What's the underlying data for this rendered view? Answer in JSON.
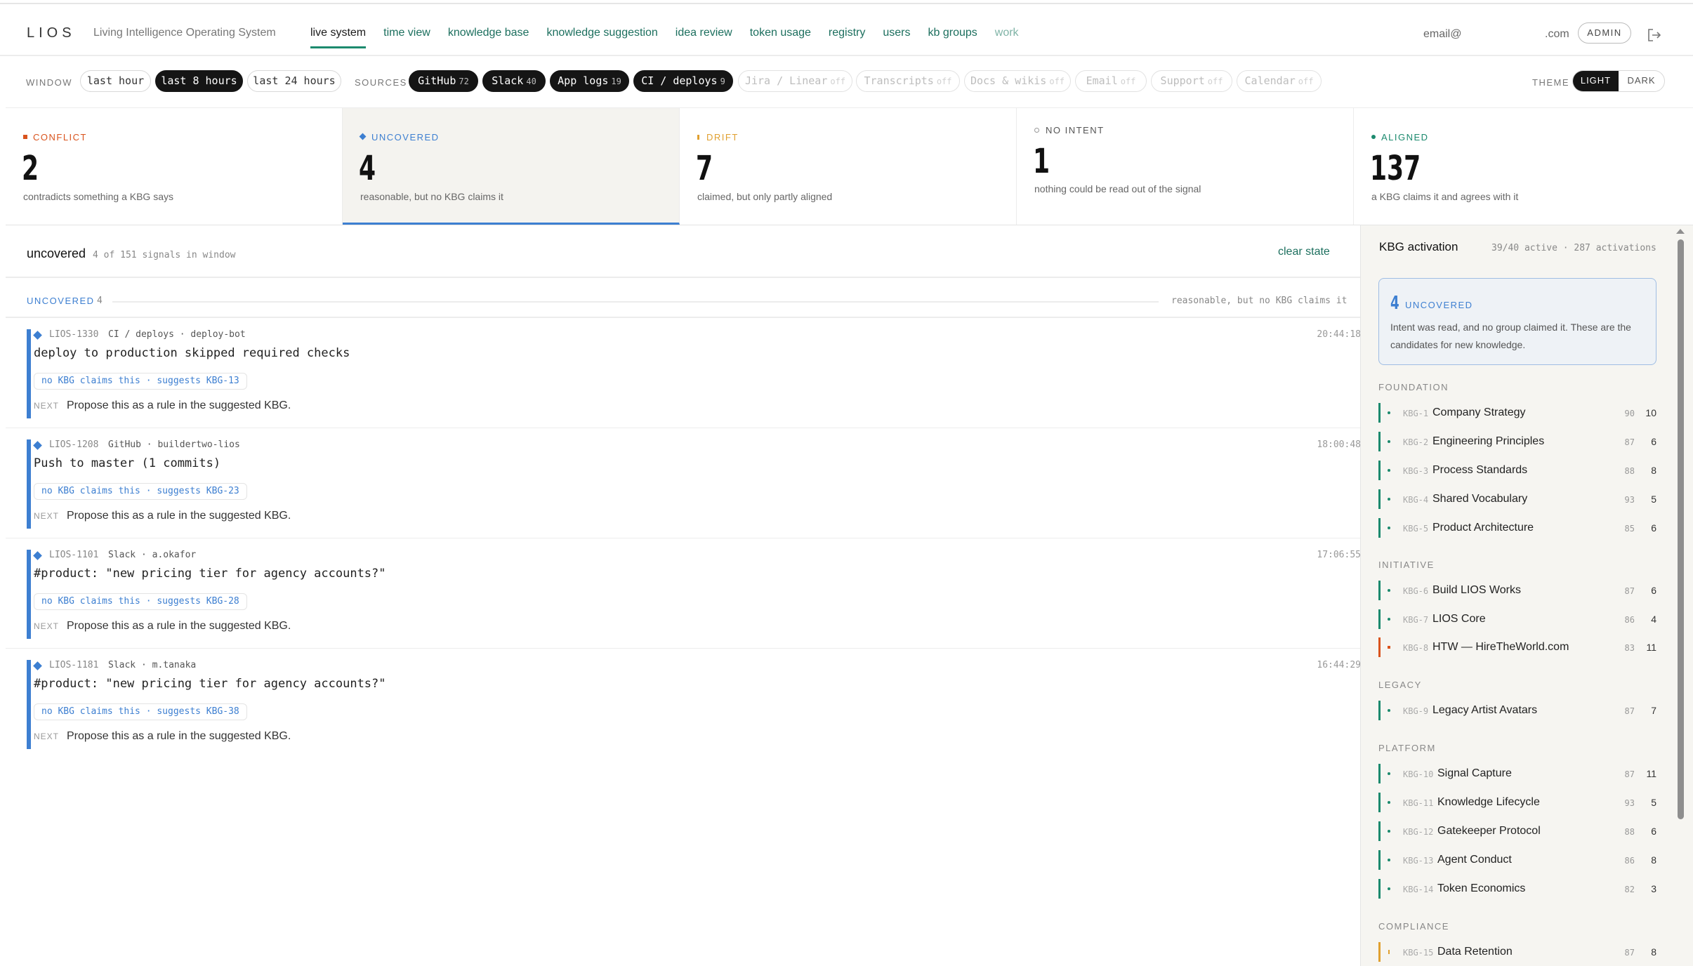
{
  "nav": {
    "logo": "LIOS",
    "tagline": "Living Intelligence Operating System",
    "tabs": [
      "live system",
      "time view",
      "knowledge base",
      "knowledge suggestion",
      "idea review",
      "token usage",
      "registry",
      "users",
      "kb groups",
      "work"
    ],
    "email_left": "email@",
    "email_right": ".com",
    "role": "ADMIN"
  },
  "filters": {
    "window_label": "WINDOW",
    "windows": [
      "last hour",
      "last 8 hours",
      "last 24 hours"
    ],
    "sources_label": "SOURCES",
    "sources": [
      {
        "name": "GitHub",
        "count": "72",
        "state": "on"
      },
      {
        "name": "Slack",
        "count": "40",
        "state": "on"
      },
      {
        "name": "App logs",
        "count": "19",
        "state": "on"
      },
      {
        "name": "CI / deploys",
        "count": "9",
        "state": "on"
      },
      {
        "name": "Jira / Linear",
        "count": "off",
        "state": "off"
      },
      {
        "name": "Transcripts",
        "count": "off",
        "state": "off"
      },
      {
        "name": "Docs & wikis",
        "count": "off",
        "state": "off"
      },
      {
        "name": "Email",
        "count": "off",
        "state": "off"
      },
      {
        "name": "Support",
        "count": "off",
        "state": "off"
      },
      {
        "name": "Calendar",
        "count": "off",
        "state": "off"
      }
    ],
    "theme_label": "THEME",
    "theme_light": "LIGHT",
    "theme_dark": "DARK"
  },
  "stats": [
    {
      "label": "CONFLICT",
      "value": "2",
      "desc": "contradicts something a KBG says",
      "color": "#d9541e"
    },
    {
      "label": "UNCOVERED",
      "value": "4",
      "desc": "reasonable, but no KBG claims it",
      "color": "#3d7fd1"
    },
    {
      "label": "DRIFT",
      "value": "7",
      "desc": "claimed, but only partly aligned",
      "color": "#e0a030"
    },
    {
      "label": "NO INTENT",
      "value": "1",
      "desc": "nothing could be read out of the signal",
      "color": "#888888"
    },
    {
      "label": "ALIGNED",
      "value": "137",
      "desc": "a KBG claims it and agrees with it",
      "color": "#1c8a6e"
    }
  ],
  "main": {
    "state_title": "uncovered",
    "state_count": "4 of 151 signals in window",
    "clear_label": "clear state",
    "group_label": "UNCOVERED",
    "group_count": "4",
    "group_desc": "reasonable, but no KBG claims it",
    "signals": [
      {
        "id": "LIOS-1330",
        "source": "CI / deploys · deploy-bot",
        "time": "20:44:18",
        "title": "deploy to production skipped required checks",
        "claim": "no KBG claims this · suggests KBG-13",
        "next_label": "NEXT",
        "next": "Propose this as a rule in the suggested KBG."
      },
      {
        "id": "LIOS-1208",
        "source": "GitHub · buildertwo-lios",
        "time": "18:00:48",
        "title": "Push to master (1 commits)",
        "claim": "no KBG claims this · suggests KBG-23",
        "next_label": "NEXT",
        "next": "Propose this as a rule in the suggested KBG."
      },
      {
        "id": "LIOS-1101",
        "source": "Slack · a.okafor",
        "time": "17:06:55",
        "title": "#product: \"new pricing tier for agency accounts?\"",
        "claim": "no KBG claims this · suggests KBG-28",
        "next_label": "NEXT",
        "next": "Propose this as a rule in the suggested KBG."
      },
      {
        "id": "LIOS-1181",
        "source": "Slack · m.tanaka",
        "time": "16:44:29",
        "title": "#product: \"new pricing tier for agency accounts?\"",
        "claim": "no KBG claims this · suggests KBG-38",
        "next_label": "NEXT",
        "next": "Propose this as a rule in the suggested KBG."
      }
    ]
  },
  "sidebar": {
    "title": "KBG activation",
    "stats": "39/40 active · 287 activations",
    "card_num": "4",
    "card_label": "UNCOVERED",
    "card_text": "Intent was read, and no group claimed it. These are the candidates for new knowledge.",
    "groups": [
      {
        "name": "FOUNDATION",
        "items": [
          {
            "id": "KBG-1",
            "name": "Company Strategy",
            "score": "90",
            "count": "10",
            "status": "green"
          },
          {
            "id": "KBG-2",
            "name": "Engineering Principles",
            "score": "87",
            "count": "6",
            "status": "green"
          },
          {
            "id": "KBG-3",
            "name": "Process Standards",
            "score": "88",
            "count": "8",
            "status": "green"
          },
          {
            "id": "KBG-4",
            "name": "Shared Vocabulary",
            "score": "93",
            "count": "5",
            "status": "green"
          },
          {
            "id": "KBG-5",
            "name": "Product Architecture",
            "score": "85",
            "count": "6",
            "status": "green"
          }
        ]
      },
      {
        "name": "INITIATIVE",
        "items": [
          {
            "id": "KBG-6",
            "name": "Build LIOS Works",
            "score": "87",
            "count": "6",
            "status": "green"
          },
          {
            "id": "KBG-7",
            "name": "LIOS Core",
            "score": "86",
            "count": "4",
            "status": "green"
          },
          {
            "id": "KBG-8",
            "name": "HTW — HireTheWorld.com",
            "score": "83",
            "count": "11",
            "status": "red"
          }
        ]
      },
      {
        "name": "LEGACY",
        "items": [
          {
            "id": "KBG-9",
            "name": "Legacy Artist Avatars",
            "score": "87",
            "count": "7",
            "status": "green"
          }
        ]
      },
      {
        "name": "PLATFORM",
        "items": [
          {
            "id": "KBG-10",
            "name": "Signal Capture",
            "score": "87",
            "count": "11",
            "status": "green"
          },
          {
            "id": "KBG-11",
            "name": "Knowledge Lifecycle",
            "score": "93",
            "count": "5",
            "status": "green"
          },
          {
            "id": "KBG-12",
            "name": "Gatekeeper Protocol",
            "score": "88",
            "count": "6",
            "status": "green"
          },
          {
            "id": "KBG-13",
            "name": "Agent Conduct",
            "score": "86",
            "count": "8",
            "status": "green"
          },
          {
            "id": "KBG-14",
            "name": "Token Economics",
            "score": "82",
            "count": "3",
            "status": "green"
          }
        ]
      },
      {
        "name": "COMPLIANCE",
        "items": [
          {
            "id": "KBG-15",
            "name": "Data Retention",
            "score": "87",
            "count": "8",
            "status": "amber"
          }
        ]
      }
    ]
  }
}
